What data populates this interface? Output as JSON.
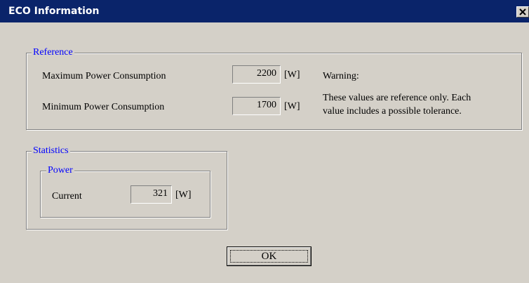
{
  "window": {
    "title": "ECO Information",
    "close_glyph": "close-icon"
  },
  "reference": {
    "legend": "Reference",
    "max_label": "Maximum Power Consumption",
    "max_value": "2200",
    "max_unit": "[W]",
    "min_label": "Minimum Power Consumption",
    "min_value": "1700",
    "min_unit": "[W]",
    "warning_title": "Warning:",
    "warning_line1": "These values are reference only. Each",
    "warning_line2": "value includes a possible tolerance."
  },
  "statistics": {
    "legend": "Statistics",
    "power": {
      "legend": "Power",
      "current_label": "Current",
      "current_value": "321",
      "current_unit": "[W]"
    }
  },
  "buttons": {
    "ok_label": "OK"
  },
  "colors": {
    "titlebar": "#0a246a",
    "face": "#d4d0c8",
    "legend_text": "#0000ff"
  }
}
